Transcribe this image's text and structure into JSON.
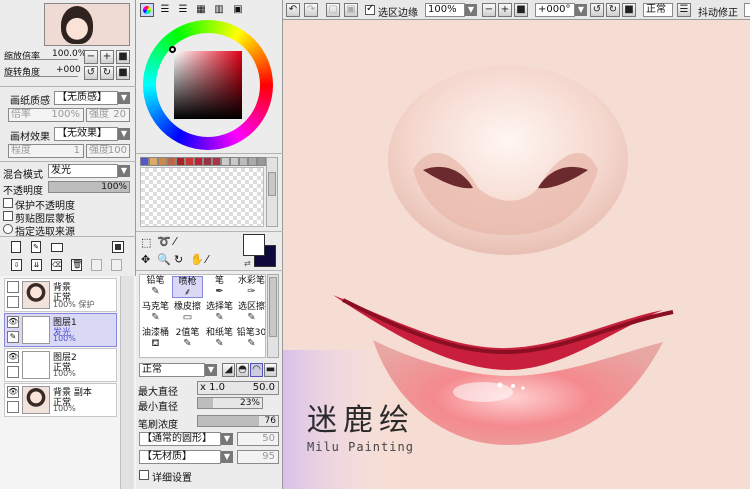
{
  "left": {
    "preview_controls": {
      "zoom_label": "缩放倍率",
      "zoom_value": "100.0%",
      "rotate_label": "旋转角度",
      "rotate_value": "+000"
    },
    "paper_texture": {
      "label": "画纸质感",
      "value": "【无质感】",
      "scale_label": "倍率",
      "scale_value": "100%",
      "strength_label": "强度",
      "strength_value": "20"
    },
    "material_effect": {
      "label": "画材效果",
      "value": "【无效果】",
      "degree_label": "程度",
      "degree_value": "1",
      "strength_label": "强度",
      "strength_value": "100"
    },
    "blend": {
      "label": "混合模式",
      "value": "发光"
    },
    "opacity": {
      "label": "不透明度",
      "value": "100%",
      "fraction": 1.0
    },
    "options": [
      {
        "label": "保护不透明度",
        "checked": false
      },
      {
        "label": "剪贴图层蒙板",
        "checked": false
      },
      {
        "label": "指定选取来源",
        "checked": false
      }
    ],
    "layers": [
      {
        "name": "背景",
        "mode": "正常",
        "opacity": "100%",
        "extra": "保护",
        "thumb": "face",
        "selected": false,
        "visible": false
      },
      {
        "name": "图层1",
        "mode": "发光",
        "opacity": "100%",
        "extra": "",
        "thumb": "blank",
        "selected": true,
        "visible": true
      },
      {
        "name": "图层2",
        "mode": "正常",
        "opacity": "100%",
        "extra": "",
        "thumb": "blank",
        "selected": false,
        "visible": true
      },
      {
        "name": "背景 副本",
        "mode": "正常",
        "opacity": "100%",
        "extra": "",
        "thumb": "face",
        "selected": false,
        "visible": true
      }
    ]
  },
  "mid": {
    "swatch_colors": [
      "#5555cc",
      "#ddaa66",
      "#cc8844",
      "#bb6644",
      "#aa2222",
      "#cc3333",
      "#bb2233",
      "#993344",
      "#aa3344",
      "#cccccc",
      "#c8c8c8",
      "#bbbbbb",
      "#aaaaaa",
      "#999999"
    ],
    "brushes": [
      {
        "name": "铅笔",
        "icon": "✎"
      },
      {
        "name": "喷枪",
        "icon": "⸙"
      },
      {
        "name": "笔",
        "icon": "✒"
      },
      {
        "name": "水彩笔",
        "icon": "✑"
      },
      {
        "name": "马克笔",
        "icon": "✎"
      },
      {
        "name": "橡皮擦",
        "icon": "▭"
      },
      {
        "name": "选择笔",
        "icon": "✎"
      },
      {
        "name": "选区擦",
        "icon": "✎"
      },
      {
        "name": "油漆桶",
        "icon": "⛾"
      },
      {
        "name": "2值笔",
        "icon": "✎"
      },
      {
        "name": "和纸笔",
        "icon": "✎"
      },
      {
        "name": "铅笔30",
        "icon": "✎"
      }
    ],
    "brush_mode": "正常",
    "max_size": {
      "label": "最大直径",
      "multiplier": "x 1.0",
      "value": "50.0"
    },
    "min_size": {
      "label": "最小直径",
      "value": "23%",
      "fraction": 0.23
    },
    "density": {
      "label": "笔刷浓度",
      "value": "76",
      "fraction": 0.76
    },
    "shape": {
      "value": "【通常的圆形】",
      "amount": "50"
    },
    "texture": {
      "value": "【无材质】",
      "amount": "95"
    },
    "detail_label": "详细设置"
  },
  "topbar": {
    "selection_border": "选区边缘",
    "zoom": "100%",
    "angle": "+000°",
    "mode": "正常",
    "stabilizer": "抖动修正"
  },
  "canvas": {
    "title_cn": "迷鹿绘",
    "title_en": "Milu Painting"
  }
}
